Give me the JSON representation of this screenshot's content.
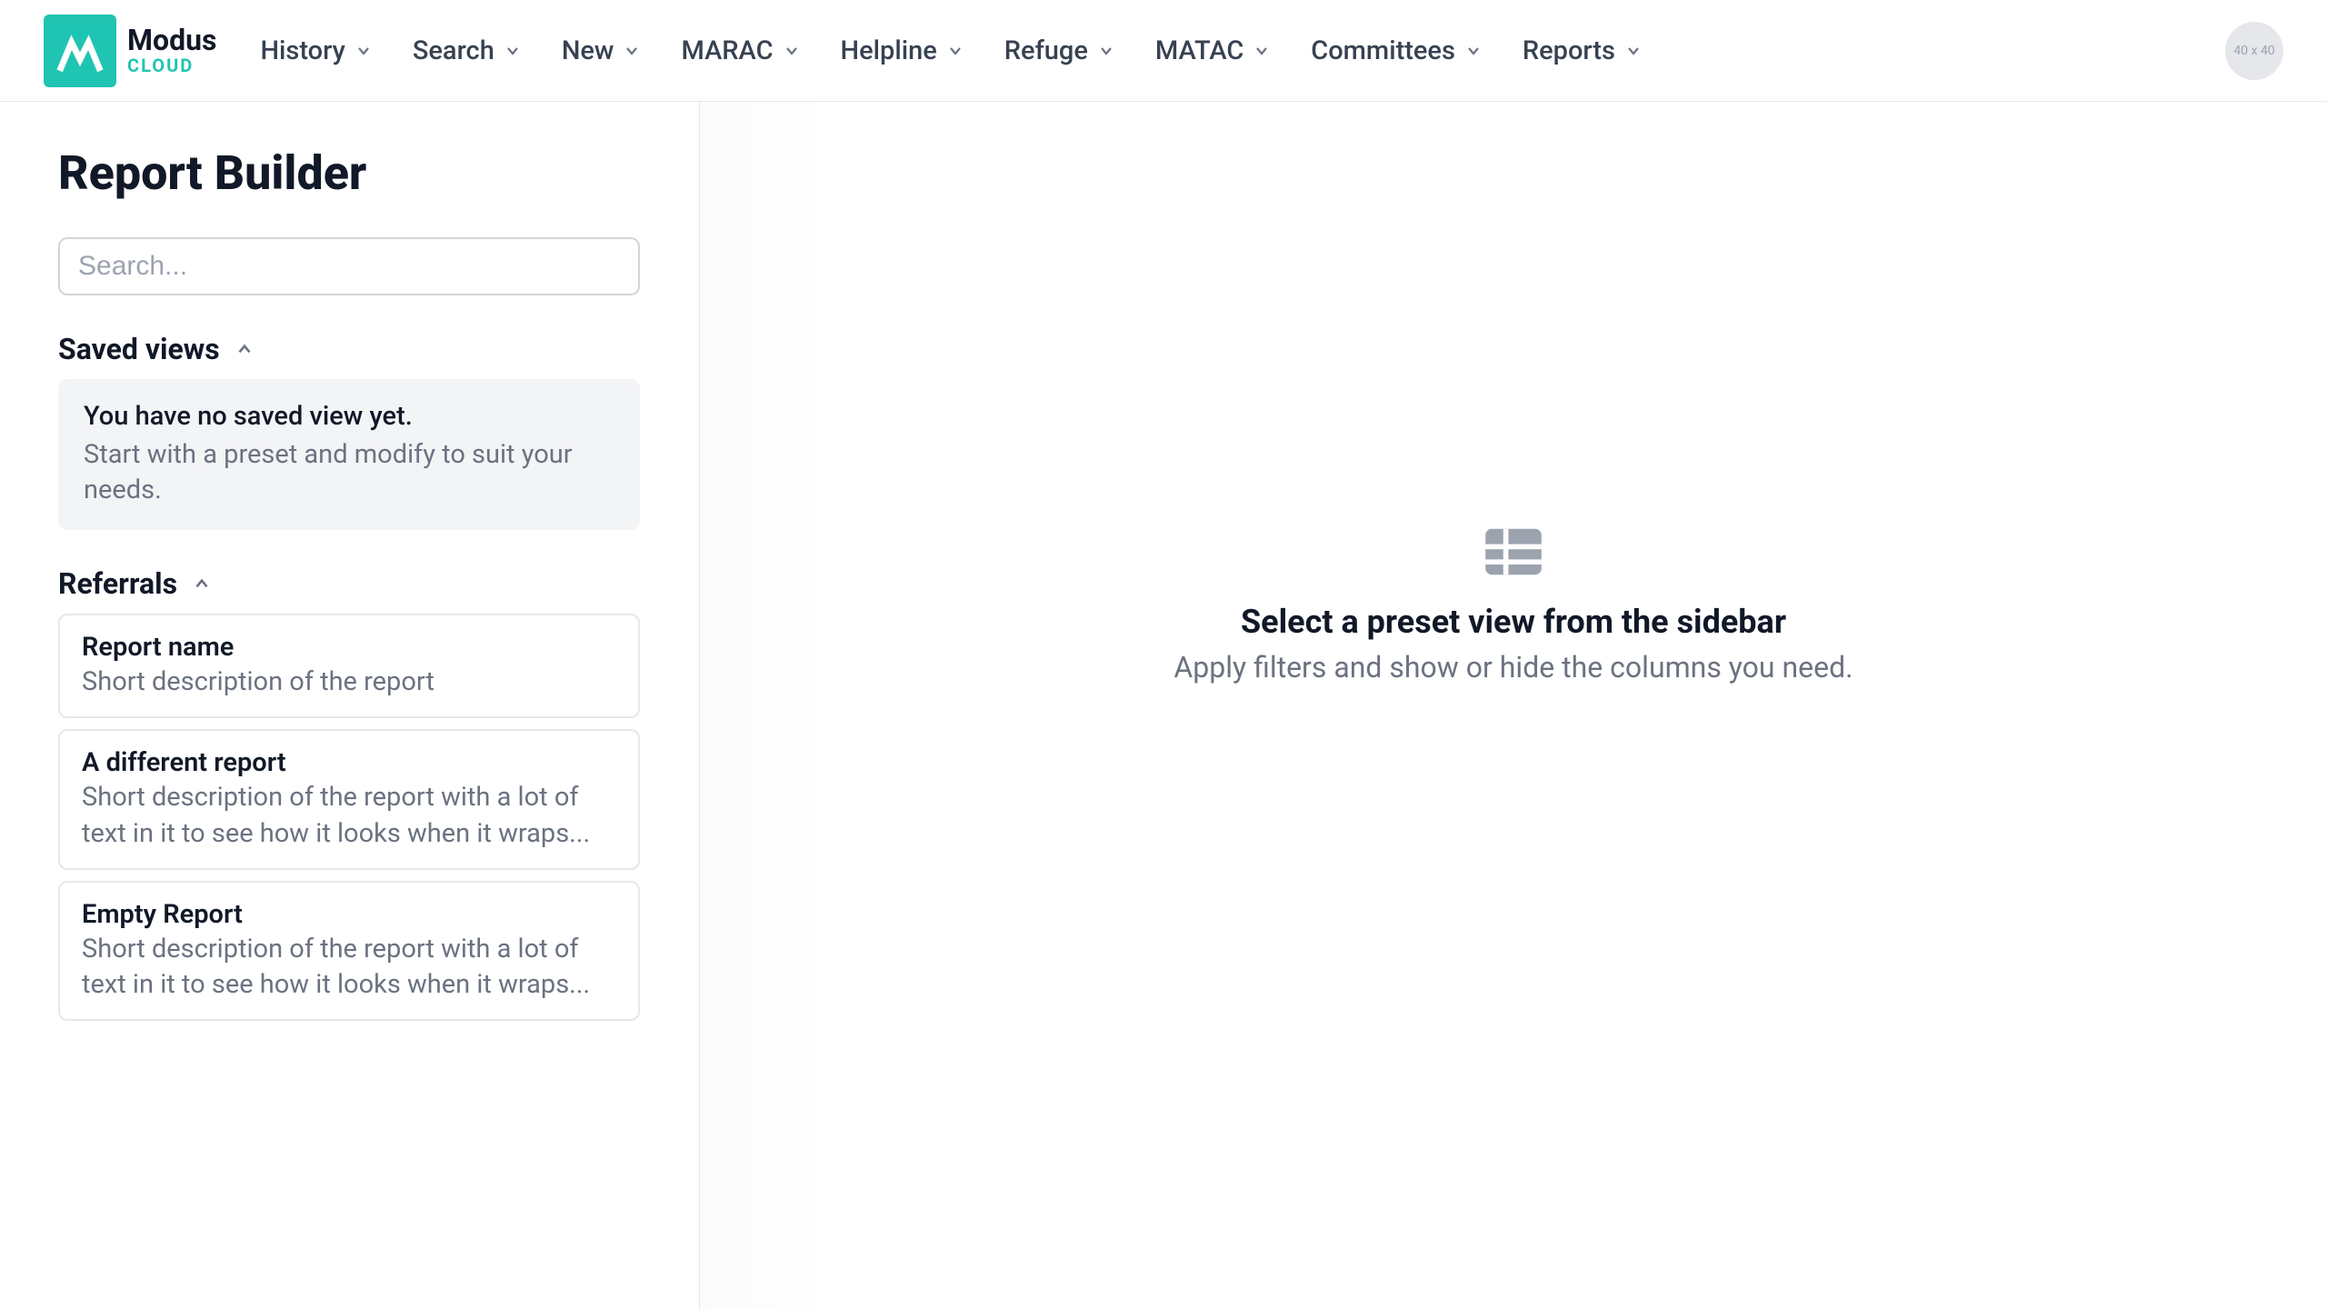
{
  "brand": {
    "name": "Modus",
    "sub": "CLOUD"
  },
  "nav": {
    "items": [
      {
        "label": "History"
      },
      {
        "label": "Search"
      },
      {
        "label": "New"
      },
      {
        "label": "MARAC"
      },
      {
        "label": "Helpline"
      },
      {
        "label": "Refuge"
      },
      {
        "label": "MATAC"
      },
      {
        "label": "Committees"
      },
      {
        "label": "Reports"
      }
    ]
  },
  "avatar": {
    "placeholder": "40 x 40"
  },
  "sidebar": {
    "title": "Report Builder",
    "search_placeholder": "Search...",
    "sections": {
      "saved_views": {
        "label": "Saved views",
        "notice_line1": "You have no saved view yet.",
        "notice_line2": "Start with a preset and modify to suit your needs."
      },
      "referrals": {
        "label": "Referrals",
        "reports": [
          {
            "title": "Report name",
            "desc": "Short description of the report"
          },
          {
            "title": "A different report",
            "desc": "Short description of the report with a lot of text in it to see how it looks when it wraps..."
          },
          {
            "title": "Empty Report",
            "desc": "Short description of the report with a lot of text in it to see how it looks when it wraps..."
          }
        ]
      }
    }
  },
  "empty_state": {
    "title": "Select a preset view from the sidebar",
    "subtitle": "Apply filters and show or hide the columns you need."
  }
}
